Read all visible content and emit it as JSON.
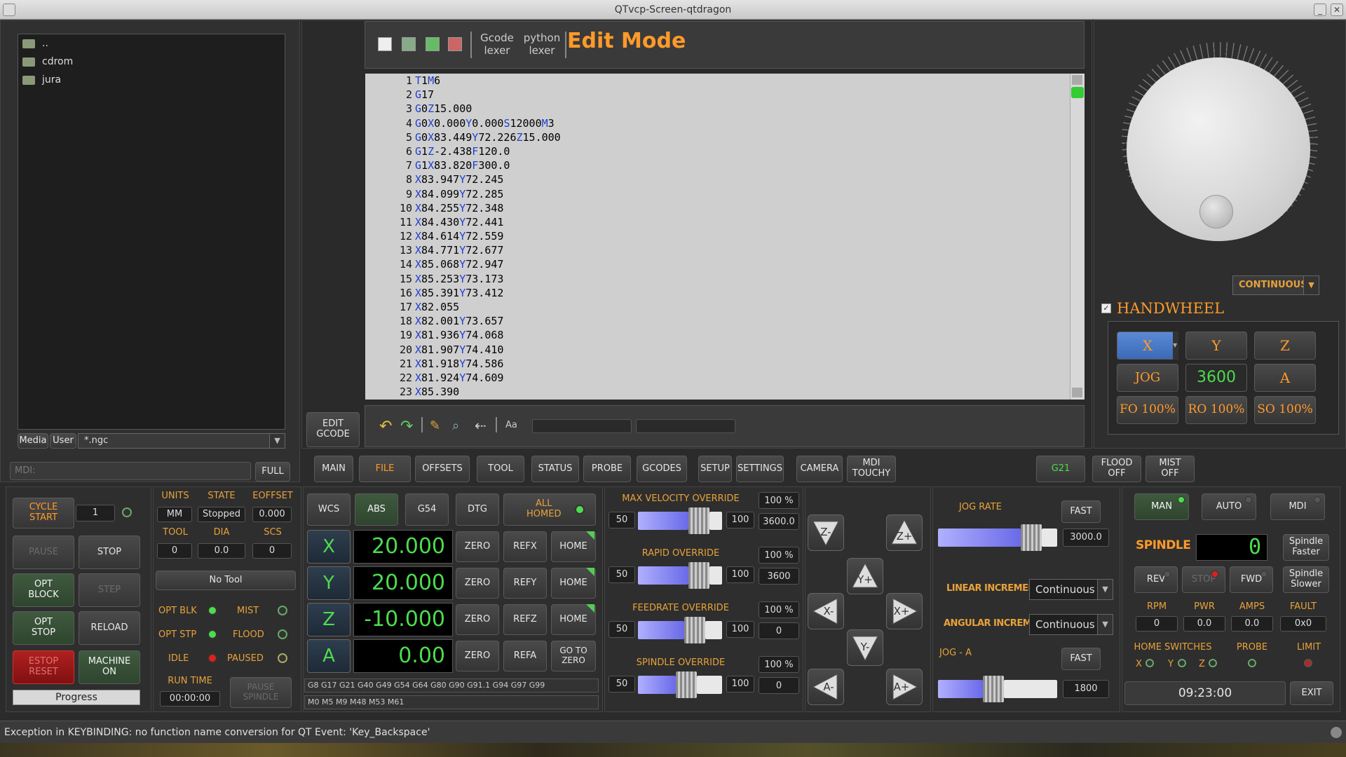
{
  "window": {
    "title": "QTvcp-Screen-qtdragon"
  },
  "files": {
    "items": [
      "..",
      "cdrom",
      "jura"
    ],
    "media": "Media",
    "user": "User",
    "filter": "*.ngc"
  },
  "mdi": {
    "placeholder": "MDI:",
    "full": "FULL"
  },
  "editor": {
    "new_label": "",
    "gcode_lexer": "Gcode\nlexer",
    "python_lexer": "python\nlexer",
    "mode": "Edit Mode",
    "edit_gcode": "EDIT\nGCODE",
    "aa": "Aa",
    "lines": [
      {
        "n": "1",
        "t": [
          [
            "k",
            "T"
          ],
          [
            "v",
            "1"
          ],
          [
            "k",
            "M"
          ],
          [
            "v",
            "6"
          ]
        ]
      },
      {
        "n": "2",
        "t": [
          [
            "k",
            "G"
          ],
          [
            "v",
            "17"
          ]
        ]
      },
      {
        "n": "3",
        "t": [
          [
            "k",
            "G"
          ],
          [
            "v",
            "0"
          ],
          [
            "k",
            "Z"
          ],
          [
            "v",
            "15.000"
          ]
        ]
      },
      {
        "n": "4",
        "t": [
          [
            "k",
            "G"
          ],
          [
            "v",
            "0"
          ],
          [
            "k",
            "X"
          ],
          [
            "v",
            "0.000"
          ],
          [
            "k",
            "Y"
          ],
          [
            "v",
            "0.000"
          ],
          [
            "k",
            "S"
          ],
          [
            "v",
            "12000"
          ],
          [
            "k",
            "M"
          ],
          [
            "v",
            "3"
          ]
        ]
      },
      {
        "n": "5",
        "t": [
          [
            "k",
            "G"
          ],
          [
            "v",
            "0"
          ],
          [
            "k",
            "X"
          ],
          [
            "v",
            "83.449"
          ],
          [
            "k",
            "Y"
          ],
          [
            "v",
            "72.226"
          ],
          [
            "k",
            "Z"
          ],
          [
            "v",
            "15.000"
          ]
        ]
      },
      {
        "n": "6",
        "t": [
          [
            "k",
            "G"
          ],
          [
            "v",
            "1"
          ],
          [
            "k",
            "Z"
          ],
          [
            "v",
            "-2.438"
          ],
          [
            "k",
            "F"
          ],
          [
            "v",
            "120.0"
          ]
        ]
      },
      {
        "n": "7",
        "t": [
          [
            "k",
            "G"
          ],
          [
            "v",
            "1"
          ],
          [
            "k",
            "X"
          ],
          [
            "v",
            "83.820"
          ],
          [
            "k",
            "F"
          ],
          [
            "v",
            "300.0"
          ]
        ]
      },
      {
        "n": "8",
        "t": [
          [
            "k",
            "X"
          ],
          [
            "v",
            "83.947"
          ],
          [
            "k",
            "Y"
          ],
          [
            "v",
            "72.245"
          ]
        ]
      },
      {
        "n": "9",
        "t": [
          [
            "k",
            "X"
          ],
          [
            "v",
            "84.099"
          ],
          [
            "k",
            "Y"
          ],
          [
            "v",
            "72.285"
          ]
        ]
      },
      {
        "n": "10",
        "t": [
          [
            "k",
            "X"
          ],
          [
            "v",
            "84.255"
          ],
          [
            "k",
            "Y"
          ],
          [
            "v",
            "72.348"
          ]
        ]
      },
      {
        "n": "11",
        "t": [
          [
            "k",
            "X"
          ],
          [
            "v",
            "84.430"
          ],
          [
            "k",
            "Y"
          ],
          [
            "v",
            "72.441"
          ]
        ]
      },
      {
        "n": "12",
        "t": [
          [
            "k",
            "X"
          ],
          [
            "v",
            "84.614"
          ],
          [
            "k",
            "Y"
          ],
          [
            "v",
            "72.559"
          ]
        ]
      },
      {
        "n": "13",
        "t": [
          [
            "k",
            "X"
          ],
          [
            "v",
            "84.771"
          ],
          [
            "k",
            "Y"
          ],
          [
            "v",
            "72.677"
          ]
        ]
      },
      {
        "n": "14",
        "t": [
          [
            "k",
            "X"
          ],
          [
            "v",
            "85.068"
          ],
          [
            "k",
            "Y"
          ],
          [
            "v",
            "72.947"
          ]
        ]
      },
      {
        "n": "15",
        "t": [
          [
            "k",
            "X"
          ],
          [
            "v",
            "85.253"
          ],
          [
            "k",
            "Y"
          ],
          [
            "v",
            "73.173"
          ]
        ]
      },
      {
        "n": "16",
        "t": [
          [
            "k",
            "X"
          ],
          [
            "v",
            "85.391"
          ],
          [
            "k",
            "Y"
          ],
          [
            "v",
            "73.412"
          ]
        ]
      },
      {
        "n": "17",
        "t": [
          [
            "k",
            "X"
          ],
          [
            "v",
            "82.055"
          ]
        ]
      },
      {
        "n": "18",
        "t": [
          [
            "k",
            "X"
          ],
          [
            "v",
            "82.001"
          ],
          [
            "k",
            "Y"
          ],
          [
            "v",
            "73.657"
          ]
        ]
      },
      {
        "n": "19",
        "t": [
          [
            "k",
            "X"
          ],
          [
            "v",
            "81.936"
          ],
          [
            "k",
            "Y"
          ],
          [
            "v",
            "74.068"
          ]
        ]
      },
      {
        "n": "20",
        "t": [
          [
            "k",
            "X"
          ],
          [
            "v",
            "81.907"
          ],
          [
            "k",
            "Y"
          ],
          [
            "v",
            "74.410"
          ]
        ]
      },
      {
        "n": "21",
        "t": [
          [
            "k",
            "X"
          ],
          [
            "v",
            "81.918"
          ],
          [
            "k",
            "Y"
          ],
          [
            "v",
            "74.586"
          ]
        ]
      },
      {
        "n": "22",
        "t": [
          [
            "k",
            "X"
          ],
          [
            "v",
            "81.924"
          ],
          [
            "k",
            "Y"
          ],
          [
            "v",
            "74.609"
          ]
        ]
      },
      {
        "n": "23",
        "t": [
          [
            "k",
            "X"
          ],
          [
            "v",
            "85.390"
          ]
        ]
      }
    ]
  },
  "handwheel": {
    "mode": "CONTINUOUS",
    "label": "HANDWHEEL",
    "axes": [
      "X",
      "Y",
      "Z"
    ],
    "jog": "JOG",
    "count": "3600",
    "axis_a": "A",
    "fo": "FO 100%",
    "ro": "RO 100%",
    "so": "SO 100%"
  },
  "tabs": [
    "MAIN",
    "FILE",
    "OFFSETS",
    "TOOL",
    "STATUS",
    "PROBE",
    "GCODES",
    "SETUP",
    "SETTINGS",
    "CAMERA",
    "MDI\nTOUCHY"
  ],
  "top_right": {
    "g21": "G21",
    "flood": "FLOOD\nOFF",
    "mist": "MIST\nOFF"
  },
  "controls": {
    "cycle_start": "CYCLE\nSTART",
    "cycle_count": "1",
    "pause": "PAUSE",
    "stop": "STOP",
    "opt_block": "OPT\nBLOCK",
    "step": "STEP",
    "opt_stop": "OPT\nSTOP",
    "reload": "RELOAD",
    "estop": "ESTOP\nRESET",
    "machine_on": "MACHINE\nON",
    "progress": "Progress"
  },
  "status": {
    "units_lbl": "UNITS",
    "state_lbl": "STATE",
    "eoffset_lbl": "EOFFSET",
    "units": "MM",
    "state": "Stopped",
    "eoffset": "0.000",
    "tool_lbl": "TOOL",
    "dia_lbl": "DIA",
    "scs_lbl": "SCS",
    "tool": "0",
    "dia": "0.0",
    "scs": "0",
    "no_tool": "No Tool",
    "opt_blk": "OPT BLK",
    "mist": "MIST",
    "opt_stp": "OPT STP",
    "flood": "FLOOD",
    "idle": "IDLE",
    "paused": "PAUSED",
    "run_time_lbl": "RUN TIME",
    "run_time": "00:00:00",
    "pause_spindle": "PAUSE\nSPINDLE"
  },
  "dro": {
    "wcs": "WCS",
    "abs": "ABS",
    "g54": "G54",
    "dtg": "DTG",
    "all_homed": "ALL\nHOMED",
    "axes": [
      {
        "name": "X",
        "value": "20.000",
        "zero": "ZERO",
        "ref": "REFX",
        "home": "HOME"
      },
      {
        "name": "Y",
        "value": "20.000",
        "zero": "ZERO",
        "ref": "REFY",
        "home": "HOME"
      },
      {
        "name": "Z",
        "value": "-10.000",
        "zero": "ZERO",
        "ref": "REFZ",
        "home": "HOME"
      },
      {
        "name": "A",
        "value": "0.00",
        "zero": "ZERO",
        "ref": "REFA",
        "home": "GO TO\nZERO"
      }
    ],
    "gcodes": "G8 G17 G21 G40 G49 G54 G64 G80 G90 G91.1 G94 G97 G99",
    "mcodes": "M0 M5 M9 M48 M53 M61"
  },
  "overrides": [
    {
      "title": "MAX VELOCITY OVERRIDE",
      "pct": "100 %",
      "min": "50",
      "max": "100",
      "value": "3600.0",
      "level": 0.6
    },
    {
      "title": "RAPID OVERRIDE",
      "pct": "100 %",
      "min": "50",
      "max": "100",
      "value": "3600",
      "level": 0.6
    },
    {
      "title": "FEEDRATE OVERRIDE",
      "pct": "100 %",
      "min": "50",
      "max": "100",
      "value": "0",
      "level": 0.55
    },
    {
      "title": "SPINDLE OVERRIDE",
      "pct": "100 %",
      "min": "50",
      "max": "100",
      "value": "0",
      "level": 0.45
    }
  ],
  "jog_buttons": {
    "zm": "Z-",
    "zp": "Z+",
    "yp": "Y+",
    "xm": "X-",
    "xp": "X+",
    "ym": "Y-",
    "am": "A-",
    "ap": "A+"
  },
  "jog": {
    "rate_lbl": "JOG RATE",
    "fast": "FAST",
    "rate": "3000.0",
    "lin_lbl": "LINEAR INCREMENT",
    "lin": "Continuous",
    "ang_lbl": "ANGULAR INCREMENT",
    "ang": "Continuous",
    "jog_a_lbl": "JOG - A",
    "fast_a": "FAST",
    "rate_a": "1800"
  },
  "spindle": {
    "man": "MAN",
    "auto": "AUTO",
    "mdi": "MDI",
    "label": "SPINDLE",
    "display": "0",
    "faster": "Spindle\nFaster",
    "slower": "Spindle\nSlower",
    "rev": "REV",
    "stop": "STOP",
    "fwd": "FWD",
    "rpm_lbl": "RPM",
    "pwr_lbl": "PWR",
    "amps_lbl": "AMPS",
    "fault_lbl": "FAULT",
    "rpm": "0",
    "pwr": "0.0",
    "amps": "0.0",
    "fault": "0x0",
    "home_sw": "HOME SWITCHES",
    "probe": "PROBE",
    "limit": "LIMIT",
    "hx": "X",
    "hy": "Y",
    "hz": "Z",
    "clock": "09:23:00",
    "exit": "EXIT"
  },
  "statusbar": {
    "message": "Exception in KEYBINDING: no function name conversion for QT Event: 'Key_Backspace'"
  }
}
